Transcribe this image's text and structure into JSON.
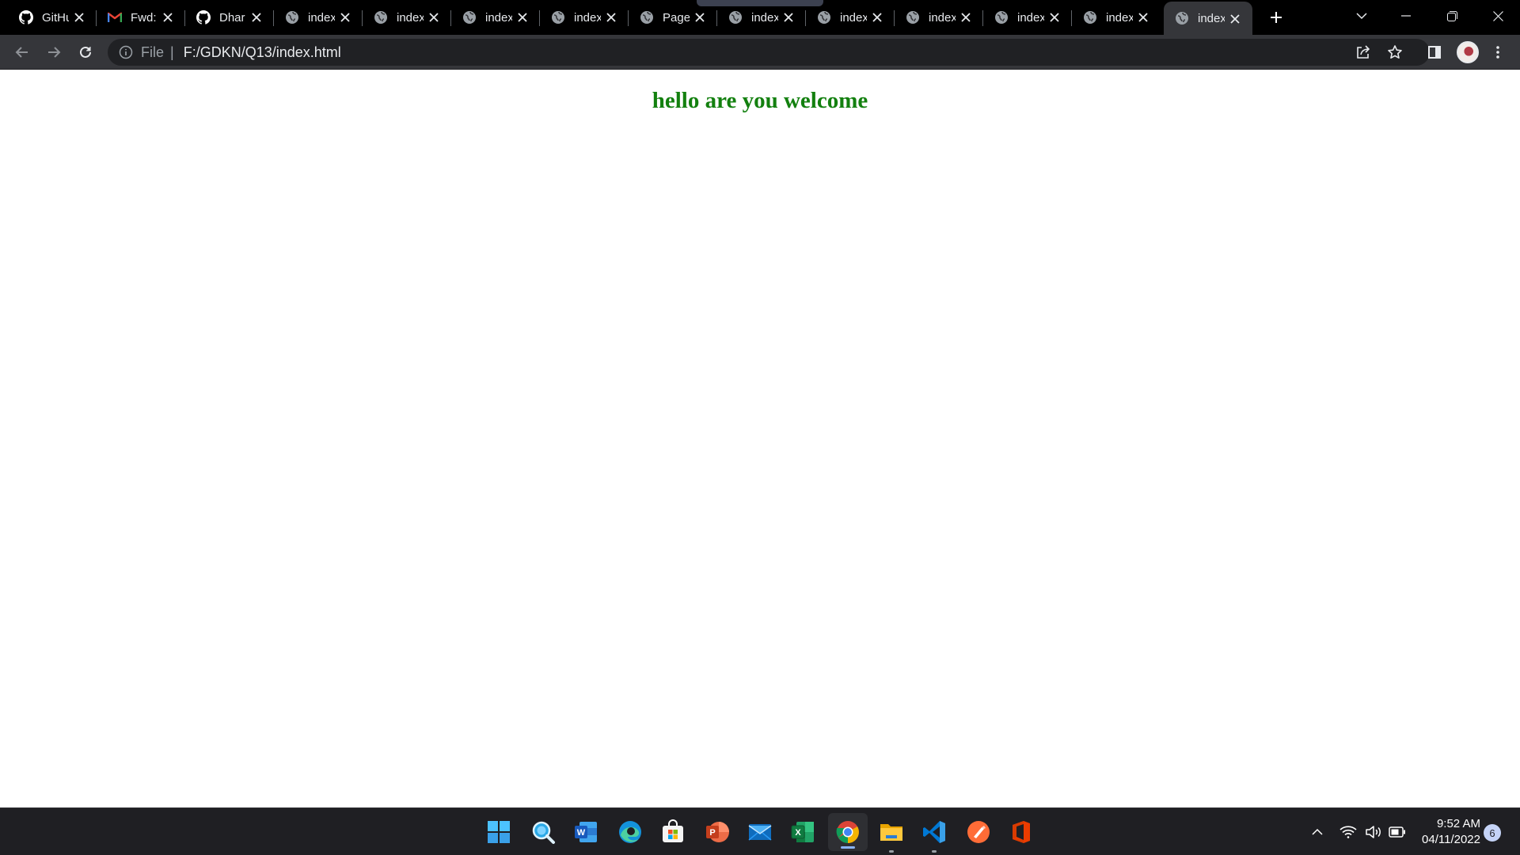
{
  "browser": {
    "tabs": [
      {
        "favicon": "github-icon",
        "title": "GitHub"
      },
      {
        "favicon": "gmail-icon",
        "title": "Fwd:"
      },
      {
        "favicon": "github-icon",
        "title": "Dhar"
      },
      {
        "favicon": "globe-icon",
        "title": "index"
      },
      {
        "favicon": "globe-icon",
        "title": "index"
      },
      {
        "favicon": "globe-icon",
        "title": "index"
      },
      {
        "favicon": "globe-icon",
        "title": "index"
      },
      {
        "favicon": "globe-icon",
        "title": "Page"
      },
      {
        "favicon": "globe-icon",
        "title": "index"
      },
      {
        "favicon": "globe-icon",
        "title": "index"
      },
      {
        "favicon": "globe-icon",
        "title": "index"
      },
      {
        "favicon": "globe-icon",
        "title": "index"
      },
      {
        "favicon": "globe-icon",
        "title": "index"
      },
      {
        "favicon": "globe-icon",
        "title": "index",
        "active": true
      }
    ],
    "address_bar": {
      "scheme_label": "File",
      "url": "F:/GDKN/Q13/index.html"
    }
  },
  "page": {
    "heading": "hello are you welcome",
    "heading_color": "#13800f"
  },
  "taskbar": {
    "apps": [
      {
        "name": "start-icon"
      },
      {
        "name": "search-icon"
      },
      {
        "name": "word-icon"
      },
      {
        "name": "edge-icon"
      },
      {
        "name": "store-icon"
      },
      {
        "name": "powerpoint-icon"
      },
      {
        "name": "mail-icon"
      },
      {
        "name": "excel-icon"
      },
      {
        "name": "chrome-icon",
        "active": true
      },
      {
        "name": "file-explorer-icon"
      },
      {
        "name": "vscode-icon"
      },
      {
        "name": "postman-icon"
      },
      {
        "name": "office-icon"
      }
    ],
    "clock": {
      "time": "9:52 AM",
      "date": "04/11/2022"
    },
    "notification_count": "6"
  },
  "colors": {
    "tabstrip_bg": "#000000",
    "toolbar_bg": "#35363a",
    "omnibox_bg": "#202124",
    "taskbar_bg": "#1f1f23"
  }
}
